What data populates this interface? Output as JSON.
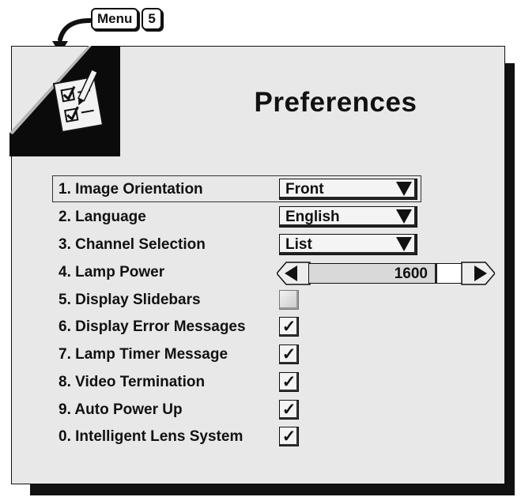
{
  "keys": {
    "menu": "Menu",
    "number": "5"
  },
  "title": "Preferences",
  "rows": [
    {
      "label": "1. Image Orientation",
      "type": "dropdown",
      "value": "Front",
      "selected": true
    },
    {
      "label": "2. Language",
      "type": "dropdown",
      "value": "English"
    },
    {
      "label": "3. Channel Selection",
      "type": "dropdown",
      "value": "List"
    },
    {
      "label": "4. Lamp Power",
      "type": "slider",
      "value": "1600",
      "level": 0.8
    },
    {
      "label": "5. Display Slidebars",
      "type": "checkbox",
      "checked": false
    },
    {
      "label": "6. Display Error Messages",
      "type": "checkbox",
      "checked": true
    },
    {
      "label": "7. Lamp Timer Message",
      "type": "checkbox",
      "checked": true
    },
    {
      "label": "8. Video Termination",
      "type": "checkbox",
      "checked": true
    },
    {
      "label": "9. Auto Power Up",
      "type": "checkbox",
      "checked": true
    },
    {
      "label": "0. Intelligent Lens System",
      "type": "checkbox",
      "checked": true
    }
  ],
  "icons": {
    "corner": "checklist-icon",
    "arrow": "curved-arrow-icon",
    "dropdown": "triangle-down-icon",
    "slider_left": "triangle-left-icon",
    "slider_right": "triangle-right-icon",
    "check": "checkmark-icon"
  }
}
